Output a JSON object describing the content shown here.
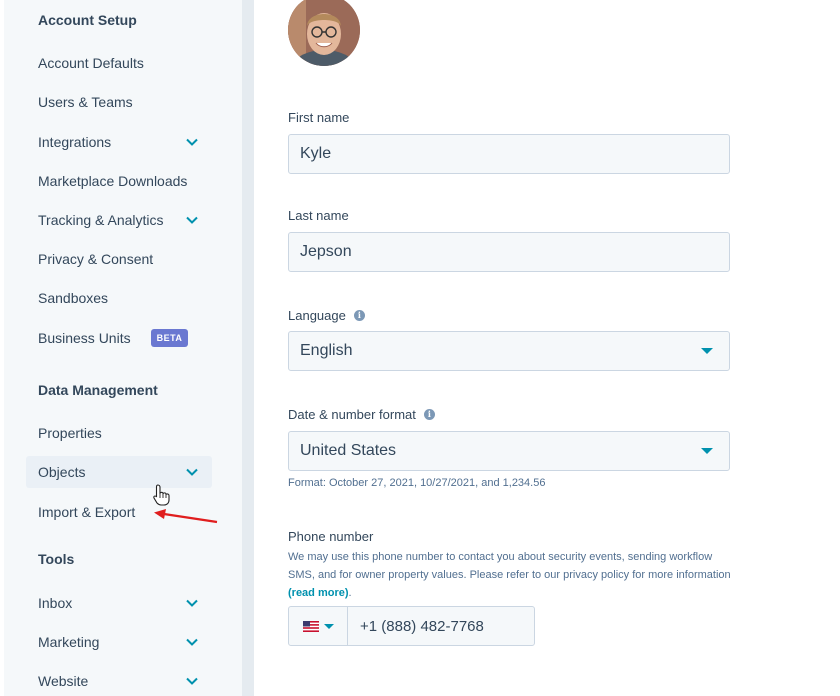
{
  "sidebar": {
    "sections": [
      {
        "title": "Account Setup"
      },
      {
        "title": "Data Management"
      },
      {
        "title": "Tools"
      }
    ],
    "items": {
      "account_defaults": "Account Defaults",
      "users_teams": "Users & Teams",
      "integrations": "Integrations",
      "marketplace_downloads": "Marketplace Downloads",
      "tracking_analytics": "Tracking & Analytics",
      "privacy_consent": "Privacy & Consent",
      "sandboxes": "Sandboxes",
      "business_units": "Business Units",
      "business_units_badge": "BETA",
      "properties": "Properties",
      "objects": "Objects",
      "import_export": "Import & Export",
      "inbox": "Inbox",
      "marketing": "Marketing",
      "website": "Website"
    }
  },
  "profile": {
    "first_name_label": "First name",
    "first_name_value": "Kyle",
    "last_name_label": "Last name",
    "last_name_value": "Jepson",
    "language_label": "Language",
    "language_value": "English",
    "date_format_label": "Date & number format",
    "date_format_value": "United States",
    "date_format_help": "Format: October 27, 2021, 10/27/2021, and 1,234.56",
    "phone_label": "Phone number",
    "phone_help": "We may use this phone number to contact you about security events, sending workflow SMS, and for owner property values. Please refer to our privacy policy for more information",
    "phone_help_link": "(read more)",
    "phone_help_end": ".",
    "phone_value": "+1 (888) 482-7768"
  },
  "colors": {
    "accent": "#0091ae",
    "badge": "#6a78d1",
    "annotation_arrow": "#e01e1e"
  },
  "icons": {
    "chevron": "chevron-down-icon",
    "info": "info-icon",
    "flag": "us-flag-icon",
    "cursor": "hand-pointer-icon"
  }
}
